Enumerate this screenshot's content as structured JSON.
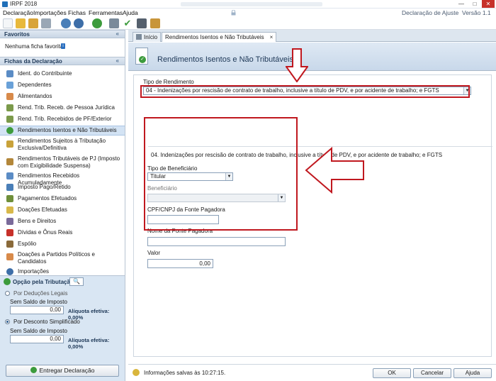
{
  "window": {
    "title": "IRPF 2018",
    "minimize": "—",
    "maximize": "□",
    "close": "✕"
  },
  "menu": {
    "items": [
      "Declaração",
      "Importações",
      "Fichas",
      "Ferramentas",
      "Ajuda"
    ],
    "declaration_type": "Declaração de Ajuste",
    "version": "Versão 1.1"
  },
  "sidebar": {
    "favorites_title": "Favoritos",
    "favorites_chevron": "«",
    "favorites_empty": "Nenhuma ficha favorita",
    "favorites_info": "i",
    "fichas_title": "Fichas da Declaração",
    "fichas_chevron": "«",
    "items": [
      "Ident. do Contribuinte",
      "Dependentes",
      "Alimentandos",
      "Rend. Trib. Receb. de Pessoa Jurídica",
      "Rend. Trib. Recebidos de PF/Exterior",
      "Rendimentos Isentos e Não Tributáveis",
      "Rendimentos Sujeitos à Tributação Exclusiva/Definitiva",
      "Rendimentos Tributáveis de PJ (Imposto com Exigibilidade Suspensa)",
      "Rendimentos Recebidos Acumuladamente",
      "Imposto Pago/Retido",
      "Pagamentos Efetuados",
      "Doações Efetuadas",
      "Bens e Direitos",
      "Dívidas e Ônus Reais",
      "Espólio",
      "Doações a Partidos Políticos e Candidatos",
      "Importações"
    ],
    "tax_option": {
      "label": "Opção pela Tributação:",
      "search_glyph": "🔍",
      "legal_deductions": "Por Deduções Legais",
      "legal_balance_label": "Sem Saldo de Imposto",
      "legal_value": "0,00",
      "legal_rate": "Alíquota efetiva: 0,00%",
      "simplified": "Por Desconto Simplificado",
      "simplified_balance_label": "Sem Saldo de Imposto",
      "simplified_value": "0,00",
      "simplified_rate": "Alíquota efetiva: 0,00%"
    },
    "deliver_button": "Entregar Declaração"
  },
  "tabs": [
    {
      "label": "Início"
    },
    {
      "label": "Rendimentos Isentos e Não Tributáveis",
      "close": "×"
    }
  ],
  "page": {
    "title": "Rendimentos Isentos e Não Tributáveis",
    "check_glyph": "✓",
    "income_type_label": "Tipo de Rendimento",
    "income_type_value": "04 - Indenizações por rescisão de contrato de trabalho, inclusive a título de PDV, e por acidente de trabalho; e FGTS",
    "section_title": "04. Indenizações por rescisão de contrato de trabalho, inclusive a título de PDV, e por acidente de trabalho; e FGTS",
    "beneficiary_type_label": "Tipo de Beneficiário",
    "beneficiary_type_value": "Titular",
    "beneficiary_label": "Beneficiário",
    "beneficiary_value": "",
    "cpf_cnpj_label": "CPF/CNPJ da Fonte Pagadora",
    "cpf_cnpj_value": "",
    "payer_name_label": "Nome da Fonte Pagadora",
    "payer_name_value": "",
    "value_label": "Valor",
    "value_value": "0,00",
    "caret_glyph": "▼"
  },
  "status": {
    "message": "Informações salvas às 10:27:15.",
    "ok": "OK",
    "cancel": "Cancelar",
    "help": "Ajuda"
  },
  "colors": {
    "accent": "#1d3756",
    "annotation_red": "#c0181f",
    "selected_item": "#d3e3f4"
  }
}
